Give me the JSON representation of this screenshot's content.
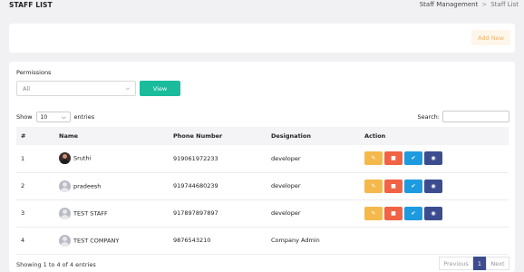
{
  "header": {
    "title": "STAFF LIST",
    "breadcrumb": {
      "parent": "Staff Management",
      "separator": ">",
      "current": "Staff List"
    }
  },
  "toolbar": {
    "add_new_label": "Add New"
  },
  "filter": {
    "permissions_label": "Permissions",
    "permissions_value": "All",
    "view_label": "View"
  },
  "table_controls": {
    "show_label": "Show",
    "entries_value": "10",
    "entries_label": "entries",
    "search_label": "Search:",
    "search_value": ""
  },
  "table": {
    "columns": [
      "#",
      "Name",
      "Phone Number",
      "Designation",
      "Action"
    ],
    "rows": [
      {
        "num": "1",
        "name": "Sruthi",
        "phone": "919061972233",
        "designation": "developer",
        "avatar": "photo",
        "has_actions": true
      },
      {
        "num": "2",
        "name": "pradeesh",
        "phone": "919744680239",
        "designation": "developer",
        "avatar": "default",
        "has_actions": true
      },
      {
        "num": "3",
        "name": "TEST STAFF",
        "phone": "917897897897",
        "designation": "developer",
        "avatar": "default",
        "has_actions": true
      },
      {
        "num": "4",
        "name": "TEST COMPANY",
        "phone": "9876543210",
        "designation": "Company Admin",
        "avatar": "default",
        "has_actions": false
      }
    ]
  },
  "footer": {
    "info": "Showing 1 to 4 of 4 entries",
    "previous_label": "Previous",
    "current_page": "1",
    "next_label": "Next"
  },
  "icons": {
    "edit": "pencil-icon",
    "delete": "trash-icon",
    "permission": "check-icon",
    "view": "eye-icon"
  },
  "colors": {
    "primary_teal": "#1abc9c",
    "edit": "#f5b94b",
    "delete": "#f16345",
    "permission": "#1e9be0",
    "view": "#3c4d8f"
  }
}
